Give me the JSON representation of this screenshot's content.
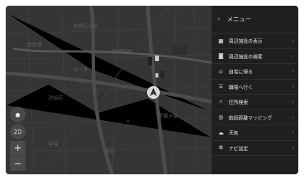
{
  "map": {
    "labels": [
      "中野区役所",
      "西新宿",
      "代々木",
      "新宿御苑",
      "千駄ヶ谷",
      "渋谷区",
      "笹塚",
      "初台"
    ],
    "mode_label": "2D"
  },
  "menu": {
    "title": "メニュー",
    "back_icon": "chevron-left-icon",
    "items": [
      {
        "label": "周辺施設の表示",
        "icon": "nearby-facilities-icon"
      },
      {
        "label": "周辺施設の検索",
        "icon": "facility-search-icon"
      },
      {
        "label": "自宅に帰る",
        "icon": "home-icon"
      },
      {
        "label": "職場へ行く",
        "icon": "workplace-icon"
      },
      {
        "label": "住所検索",
        "icon": "address-search-icon"
      },
      {
        "label": "航続距離マッピング",
        "icon": "range-mapping-icon"
      },
      {
        "label": "天気",
        "icon": "weather-icon"
      },
      {
        "label": "ナビ設定",
        "icon": "settings-gear-icon"
      }
    ]
  },
  "colors": {
    "menu_bg": "#1f1f1f",
    "map_bg": "#353535"
  }
}
